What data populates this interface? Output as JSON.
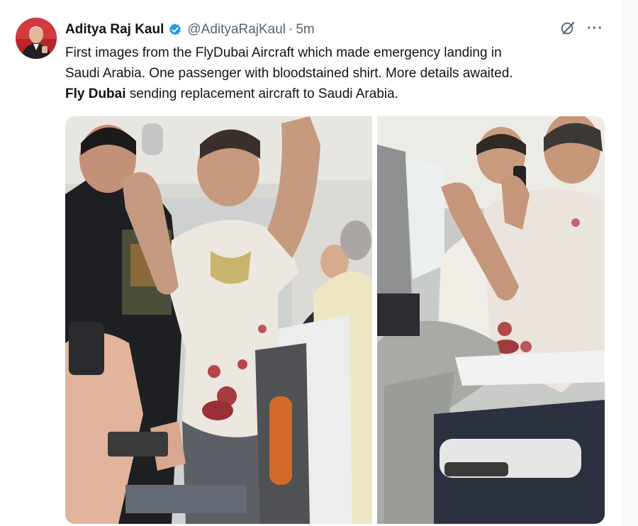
{
  "tweet": {
    "author_name": "Aditya Raj Kaul",
    "author_handle": "@AdityaRajKaul",
    "separator": "·",
    "timestamp": "5m",
    "text_line_1": "First images from the FlyDubai Aircraft which made emergency landing in",
    "text_line_2": "Saudi Arabia. One passenger with bloodstained shirt. More details awaited.",
    "text_bold": "Fly Dubai",
    "text_line_3_rest": " sending replacement aircraft to Saudi Arabia.",
    "more_label": "···"
  },
  "icons": {
    "verified": "verified-badge-icon",
    "grok": "grok-icon",
    "more": "more-options-icon"
  },
  "colors": {
    "verified_blue": "#1d9bf0",
    "secondary_text": "#536471",
    "primary_text": "#0f1419"
  }
}
